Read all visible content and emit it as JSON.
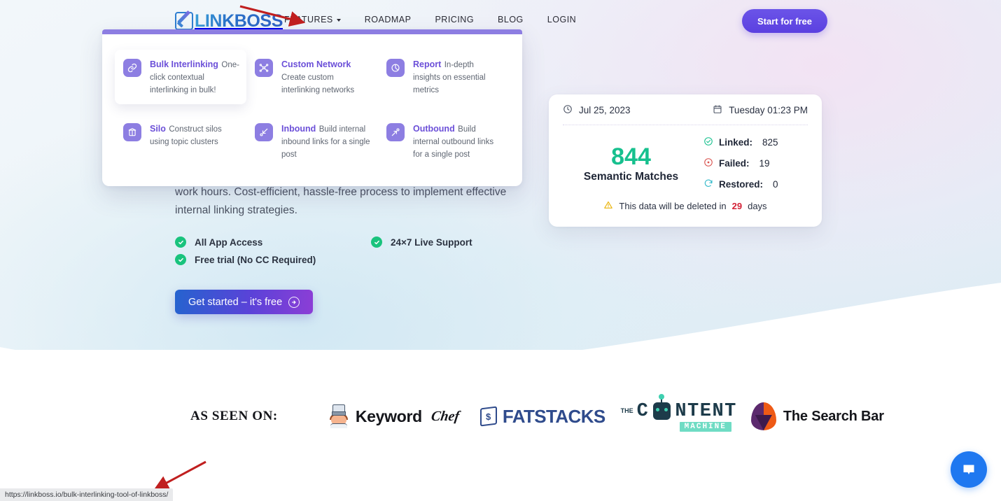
{
  "header": {
    "logo_text": "LINKBOSS",
    "logo_icon": "linkboss-logo-icon",
    "nav": [
      {
        "label": "FEATURES",
        "has_caret": true
      },
      {
        "label": "ROADMAP",
        "has_caret": false
      },
      {
        "label": "PRICING",
        "has_caret": false
      },
      {
        "label": "BLOG",
        "has_caret": false
      },
      {
        "label": "LOGIN",
        "has_caret": false
      }
    ],
    "cta_label": "Start for free",
    "cta_color": "#5b40e0"
  },
  "features_dropdown": {
    "accent_color": "#8d7ee2",
    "items": [
      {
        "title": "Bulk Interlinking",
        "desc": "One-click contextual interlinking in bulk!",
        "icon": "link-icon",
        "active": true
      },
      {
        "title": "Custom Network",
        "desc": "Create custom interlinking networks",
        "icon": "network-icon",
        "active": false
      },
      {
        "title": "Report",
        "desc": "In-depth insights on essential metrics",
        "icon": "pie-chart-icon",
        "active": false
      },
      {
        "title": "Silo",
        "desc": "Construct silos using topic clusters",
        "icon": "silo-icon",
        "active": false
      },
      {
        "title": "Inbound",
        "desc": "Build internal inbound links for a single post",
        "icon": "inbound-arrow-icon",
        "active": false
      },
      {
        "title": "Outbound",
        "desc": "Build internal outbound links for a single post",
        "icon": "outbound-arrow-icon",
        "active": false
      }
    ]
  },
  "hero": {
    "paragraph": "work hours. Cost-efficient, hassle-free process to implement effective internal linking strategies.",
    "checks": [
      "All App Access",
      "24×7 Live Support",
      "Free trial (No CC Required)"
    ],
    "cta_label": "Get started – it's free",
    "cta_icon": "arrow-right-circle-icon"
  },
  "stats_card": {
    "date": "Jul 25, 2023",
    "date_icon": "clock-icon",
    "day_time": "Tuesday 01:23 PM",
    "day_time_icon": "calendar-icon",
    "semantic_count": "844",
    "semantic_label": "Semantic Matches",
    "semantic_color": "#17c08e",
    "rows": [
      {
        "icon": "check-circle-icon",
        "icon_color": "#17c08e",
        "name": "Linked:",
        "value": "825"
      },
      {
        "icon": "x-circle-icon",
        "icon_color": "#d9534f",
        "name": "Failed:",
        "value": "19"
      },
      {
        "icon": "refresh-icon",
        "icon_color": "#2fb8c9",
        "name": "Restored:",
        "value": "0"
      }
    ],
    "footer_icon": "warning-triangle-icon",
    "footer_prefix": "This data will be deleted in",
    "footer_days": "29",
    "footer_suffix": "days",
    "footer_days_color": "#d32136"
  },
  "as_seen_on": {
    "label": "AS SEEN ON:",
    "logos": [
      {
        "name": "keyword-chef-logo",
        "word": "Keyword",
        "script": "Chef"
      },
      {
        "name": "fatstacks-logo",
        "word": "FATSTACKS",
        "mark": "$"
      },
      {
        "name": "the-content-machine-logo",
        "the": "THE",
        "word_left": "C",
        "word_right": "NTENT",
        "sub": "MACHINE"
      },
      {
        "name": "the-search-bar-logo",
        "word": "The Search Bar"
      }
    ]
  },
  "chat_widget": {
    "icon": "chat-bubble-icon",
    "color": "#1f78f0"
  },
  "status_bar": {
    "url": "https://linkboss.io/bulk-interlinking-tool-of-linkboss/"
  },
  "annotations": [
    {
      "name": "arrow-pointing-to-features",
      "color": "#c01f1f"
    },
    {
      "name": "arrow-pointing-to-status-url",
      "color": "#c01f1f"
    }
  ]
}
